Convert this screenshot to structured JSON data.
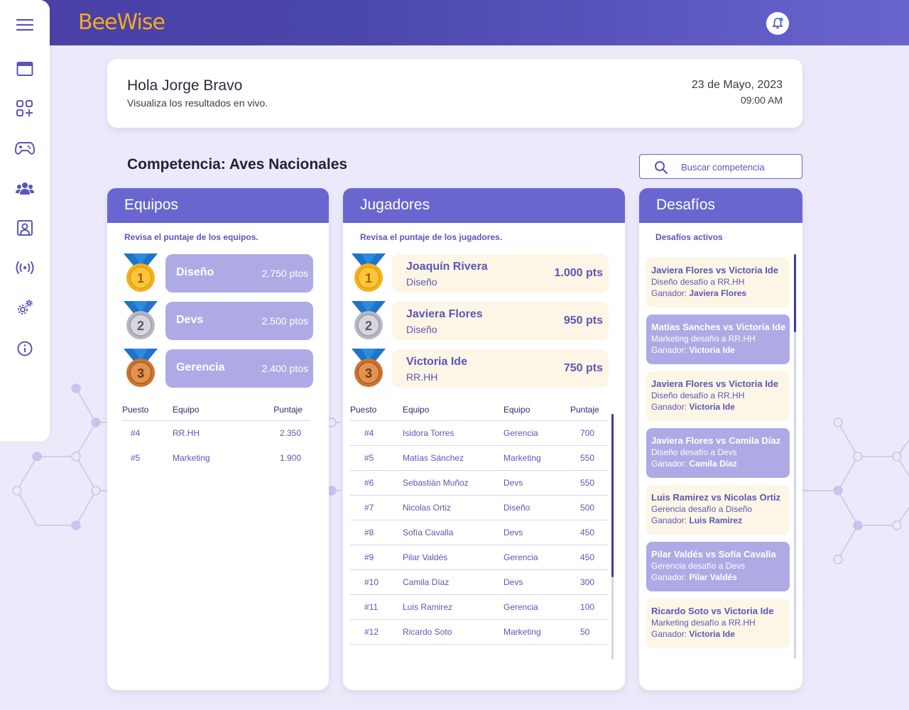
{
  "app": {
    "logo": "BeeWise"
  },
  "sidebar": {
    "items": [
      {
        "icon": "menu-icon"
      },
      {
        "icon": "window-icon"
      },
      {
        "icon": "apps-icon"
      },
      {
        "icon": "gamepad-icon"
      },
      {
        "icon": "users-icon"
      },
      {
        "icon": "profile-icon"
      },
      {
        "icon": "broadcast-icon"
      },
      {
        "icon": "settings-icon"
      },
      {
        "icon": "info-icon"
      }
    ]
  },
  "greeting": {
    "title": "Hola Jorge Bravo",
    "subtitle": "Visualiza los resultados en vivo.",
    "date": "23 de Mayo, 2023",
    "time": "09:00 AM"
  },
  "competition": {
    "title": "Competencia: Aves Nacionales"
  },
  "search": {
    "placeholder": "Buscar competencia"
  },
  "teams": {
    "header": "Equipos",
    "subtitle": "Revisa el puntaje de los equipos.",
    "podium": [
      {
        "rank": "1",
        "name": "Diseño",
        "points": "2.750 ptos"
      },
      {
        "rank": "2",
        "name": "Devs",
        "points": "2.500 ptos"
      },
      {
        "rank": "3",
        "name": "Gerencia",
        "points": "2.400 ptos"
      }
    ],
    "columns": [
      "Puesto",
      "Equipo",
      "Puntaje"
    ],
    "rows": [
      {
        "pos": "#4",
        "team": "RR.HH",
        "score": "2.350"
      },
      {
        "pos": "#5",
        "team": "Marketing",
        "score": "1.900"
      }
    ]
  },
  "players": {
    "header": "Jugadores",
    "subtitle": "Revisa el puntaje de los jugadores.",
    "podium": [
      {
        "rank": "1",
        "name": "Joaquín Rivera",
        "team": "Diseño",
        "points": "1.000 pts"
      },
      {
        "rank": "2",
        "name": "Javiera Flores",
        "team": "Diseño",
        "points": "950 pts"
      },
      {
        "rank": "3",
        "name": "Victoria Ide",
        "team": "RR.HH",
        "points": "750 pts"
      }
    ],
    "columns": [
      "Puesto",
      "Equipo",
      "Equipo",
      "Puntaje"
    ],
    "rows": [
      {
        "pos": "#4",
        "name": "Isidora Torres",
        "team": "Gerencia",
        "score": "700"
      },
      {
        "pos": "#5",
        "name": "Matías Sánchez",
        "team": "Marketing",
        "score": "550"
      },
      {
        "pos": "#6",
        "name": "Sebastián Muñoz",
        "team": "Devs",
        "score": "550"
      },
      {
        "pos": "#7",
        "name": "Nicolas Ortiz",
        "team": "Diseño",
        "score": "500"
      },
      {
        "pos": "#8",
        "name": "Sofía Cavalla",
        "team": "Devs",
        "score": "450"
      },
      {
        "pos": "#9",
        "name": "Pilar Valdés",
        "team": "Gerencia",
        "score": "450"
      },
      {
        "pos": "#10",
        "name": "Camila Díaz",
        "team": "Devs",
        "score": "300"
      },
      {
        "pos": "#11",
        "name": "Luis Ramirez",
        "team": "Gerencia",
        "score": "100"
      },
      {
        "pos": "#12",
        "name": "Ricardo Soto",
        "team": "Marketing",
        "score": "50"
      }
    ]
  },
  "challenges": {
    "header": "Desafíos",
    "subtitle": "Desafíos activos",
    "winner_label": "Ganador:",
    "items": [
      {
        "title": "Javiera Flores vs Victoria Ide",
        "desc": "Diseño desafío a RR.HH",
        "winner": "Javiera Flores"
      },
      {
        "title": "Matías Sanches vs Victoria Ide",
        "desc": "Marketing desafío a RR.HH",
        "winner": "Victoria Ide"
      },
      {
        "title": "Javiera Flores vs Victoria Ide",
        "desc": "Diseño desafío a RR.HH",
        "winner": "Victoria Ide"
      },
      {
        "title": "Javiera Flores vs Camila Díaz",
        "desc": "Diseño desafío a Devs",
        "winner": "Camila Díaz"
      },
      {
        "title": "Luis Ramirez vs Nicolas Ortiz",
        "desc": "Gerencia desafío a Diseño",
        "winner": "Luis Ramirez"
      },
      {
        "title": "Pilar Valdés vs Sofía Cavalla",
        "desc": "Gerencia desafío a Devs",
        "winner": "Pilar Valdés"
      },
      {
        "title": "Ricardo Soto vs Victoria Ide",
        "desc": "Marketing desafío a RR.HH",
        "winner": "Victoria Ide"
      }
    ]
  },
  "colors": {
    "primary": "#6a66cf",
    "accent": "#f6a91f",
    "light_card": "#fdf6e6",
    "team_pill": "#aeaae6",
    "background": "#eceafa"
  }
}
